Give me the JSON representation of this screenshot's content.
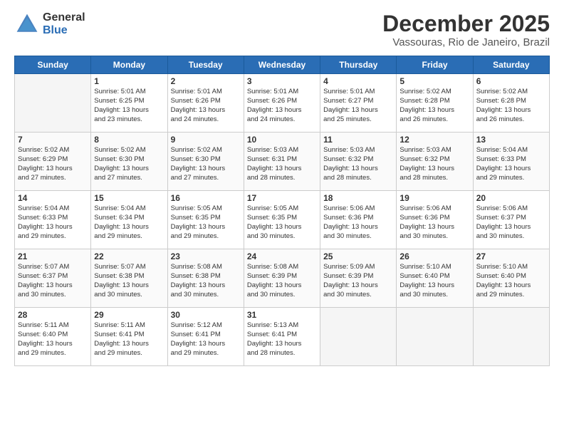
{
  "header": {
    "logo_general": "General",
    "logo_blue": "Blue",
    "month_title": "December 2025",
    "location": "Vassouras, Rio de Janeiro, Brazil"
  },
  "weekdays": [
    "Sunday",
    "Monday",
    "Tuesday",
    "Wednesday",
    "Thursday",
    "Friday",
    "Saturday"
  ],
  "weeks": [
    [
      {
        "day": "",
        "info": ""
      },
      {
        "day": "1",
        "info": "Sunrise: 5:01 AM\nSunset: 6:25 PM\nDaylight: 13 hours\nand 23 minutes."
      },
      {
        "day": "2",
        "info": "Sunrise: 5:01 AM\nSunset: 6:26 PM\nDaylight: 13 hours\nand 24 minutes."
      },
      {
        "day": "3",
        "info": "Sunrise: 5:01 AM\nSunset: 6:26 PM\nDaylight: 13 hours\nand 24 minutes."
      },
      {
        "day": "4",
        "info": "Sunrise: 5:01 AM\nSunset: 6:27 PM\nDaylight: 13 hours\nand 25 minutes."
      },
      {
        "day": "5",
        "info": "Sunrise: 5:02 AM\nSunset: 6:28 PM\nDaylight: 13 hours\nand 26 minutes."
      },
      {
        "day": "6",
        "info": "Sunrise: 5:02 AM\nSunset: 6:28 PM\nDaylight: 13 hours\nand 26 minutes."
      }
    ],
    [
      {
        "day": "7",
        "info": "Sunrise: 5:02 AM\nSunset: 6:29 PM\nDaylight: 13 hours\nand 27 minutes."
      },
      {
        "day": "8",
        "info": "Sunrise: 5:02 AM\nSunset: 6:30 PM\nDaylight: 13 hours\nand 27 minutes."
      },
      {
        "day": "9",
        "info": "Sunrise: 5:02 AM\nSunset: 6:30 PM\nDaylight: 13 hours\nand 27 minutes."
      },
      {
        "day": "10",
        "info": "Sunrise: 5:03 AM\nSunset: 6:31 PM\nDaylight: 13 hours\nand 28 minutes."
      },
      {
        "day": "11",
        "info": "Sunrise: 5:03 AM\nSunset: 6:32 PM\nDaylight: 13 hours\nand 28 minutes."
      },
      {
        "day": "12",
        "info": "Sunrise: 5:03 AM\nSunset: 6:32 PM\nDaylight: 13 hours\nand 28 minutes."
      },
      {
        "day": "13",
        "info": "Sunrise: 5:04 AM\nSunset: 6:33 PM\nDaylight: 13 hours\nand 29 minutes."
      }
    ],
    [
      {
        "day": "14",
        "info": "Sunrise: 5:04 AM\nSunset: 6:33 PM\nDaylight: 13 hours\nand 29 minutes."
      },
      {
        "day": "15",
        "info": "Sunrise: 5:04 AM\nSunset: 6:34 PM\nDaylight: 13 hours\nand 29 minutes."
      },
      {
        "day": "16",
        "info": "Sunrise: 5:05 AM\nSunset: 6:35 PM\nDaylight: 13 hours\nand 29 minutes."
      },
      {
        "day": "17",
        "info": "Sunrise: 5:05 AM\nSunset: 6:35 PM\nDaylight: 13 hours\nand 30 minutes."
      },
      {
        "day": "18",
        "info": "Sunrise: 5:06 AM\nSunset: 6:36 PM\nDaylight: 13 hours\nand 30 minutes."
      },
      {
        "day": "19",
        "info": "Sunrise: 5:06 AM\nSunset: 6:36 PM\nDaylight: 13 hours\nand 30 minutes."
      },
      {
        "day": "20",
        "info": "Sunrise: 5:06 AM\nSunset: 6:37 PM\nDaylight: 13 hours\nand 30 minutes."
      }
    ],
    [
      {
        "day": "21",
        "info": "Sunrise: 5:07 AM\nSunset: 6:37 PM\nDaylight: 13 hours\nand 30 minutes."
      },
      {
        "day": "22",
        "info": "Sunrise: 5:07 AM\nSunset: 6:38 PM\nDaylight: 13 hours\nand 30 minutes."
      },
      {
        "day": "23",
        "info": "Sunrise: 5:08 AM\nSunset: 6:38 PM\nDaylight: 13 hours\nand 30 minutes."
      },
      {
        "day": "24",
        "info": "Sunrise: 5:08 AM\nSunset: 6:39 PM\nDaylight: 13 hours\nand 30 minutes."
      },
      {
        "day": "25",
        "info": "Sunrise: 5:09 AM\nSunset: 6:39 PM\nDaylight: 13 hours\nand 30 minutes."
      },
      {
        "day": "26",
        "info": "Sunrise: 5:10 AM\nSunset: 6:40 PM\nDaylight: 13 hours\nand 30 minutes."
      },
      {
        "day": "27",
        "info": "Sunrise: 5:10 AM\nSunset: 6:40 PM\nDaylight: 13 hours\nand 29 minutes."
      }
    ],
    [
      {
        "day": "28",
        "info": "Sunrise: 5:11 AM\nSunset: 6:40 PM\nDaylight: 13 hours\nand 29 minutes."
      },
      {
        "day": "29",
        "info": "Sunrise: 5:11 AM\nSunset: 6:41 PM\nDaylight: 13 hours\nand 29 minutes."
      },
      {
        "day": "30",
        "info": "Sunrise: 5:12 AM\nSunset: 6:41 PM\nDaylight: 13 hours\nand 29 minutes."
      },
      {
        "day": "31",
        "info": "Sunrise: 5:13 AM\nSunset: 6:41 PM\nDaylight: 13 hours\nand 28 minutes."
      },
      {
        "day": "",
        "info": ""
      },
      {
        "day": "",
        "info": ""
      },
      {
        "day": "",
        "info": ""
      }
    ]
  ]
}
